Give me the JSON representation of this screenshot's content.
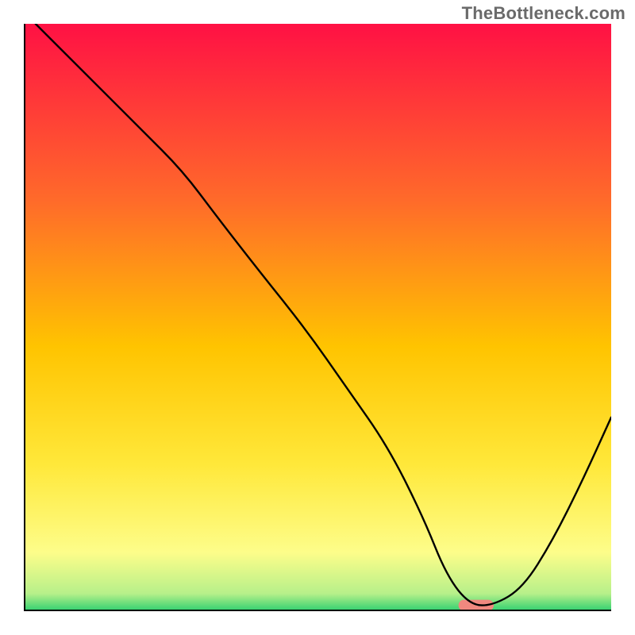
{
  "watermark": "TheBottleneck.com",
  "chart_data": {
    "type": "line",
    "title": "",
    "xlabel": "",
    "ylabel": "",
    "xlim": [
      0,
      100
    ],
    "ylim": [
      0,
      100
    ],
    "grid": false,
    "x": [
      2,
      10,
      20,
      27,
      33,
      40,
      48,
      55,
      62,
      68,
      72,
      76,
      80,
      85,
      90,
      95,
      100
    ],
    "values": [
      100,
      92,
      82,
      75,
      67,
      58,
      48,
      38,
      28,
      16,
      6,
      1,
      1,
      4,
      12,
      22,
      33
    ],
    "marker": {
      "x_start": 74,
      "x_end": 80,
      "y": 1,
      "color": "#f0887f"
    },
    "gradient_stops": [
      {
        "offset": 0.0,
        "color": "#ff1144"
      },
      {
        "offset": 0.3,
        "color": "#ff6a2a"
      },
      {
        "offset": 0.55,
        "color": "#ffc400"
      },
      {
        "offset": 0.75,
        "color": "#ffe83a"
      },
      {
        "offset": 0.9,
        "color": "#fdfd8a"
      },
      {
        "offset": 0.97,
        "color": "#b7f08a"
      },
      {
        "offset": 1.0,
        "color": "#2ed070"
      }
    ],
    "axis_color": "#000000",
    "line_color": "#000000",
    "line_width": 2.4
  }
}
